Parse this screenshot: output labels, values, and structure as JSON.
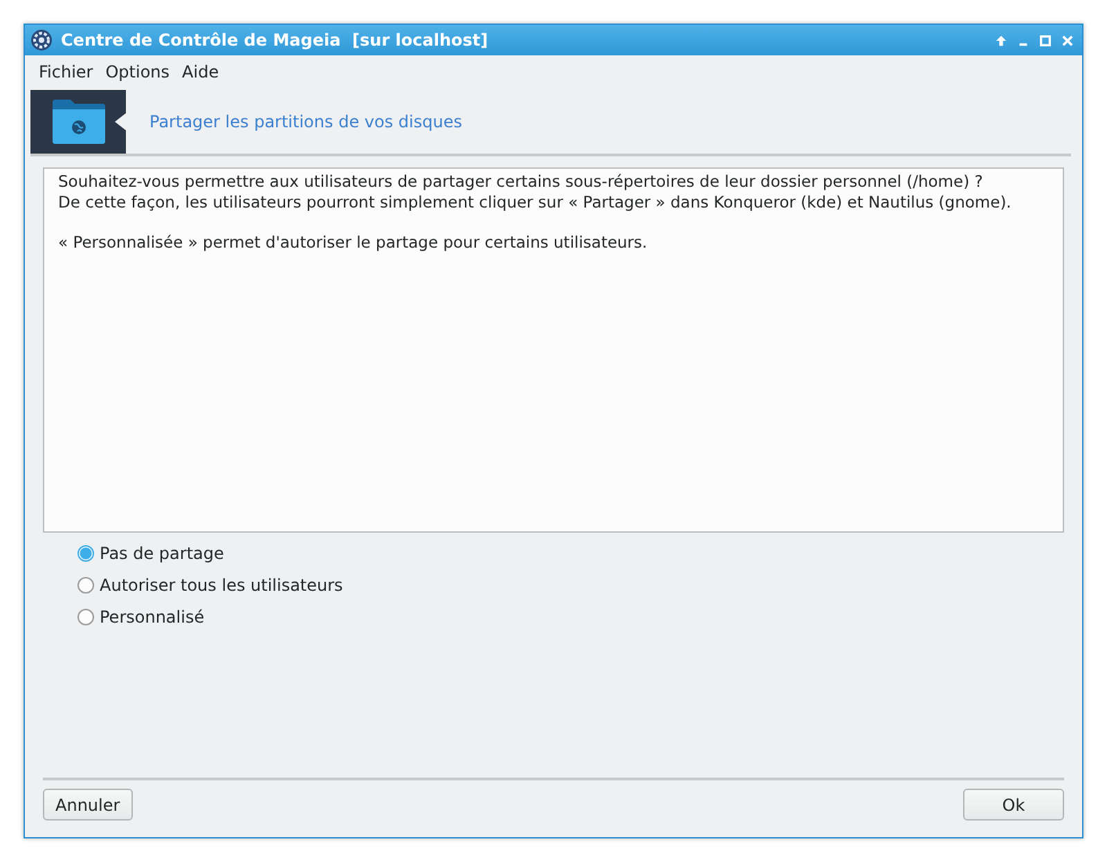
{
  "window": {
    "title": "Centre de Contrôle de Mageia  [sur localhost]"
  },
  "menu": [
    "Fichier",
    "Options",
    "Aide"
  ],
  "banner": {
    "title": "Partager les partitions de vos disques"
  },
  "message": {
    "paragraphs": [
      "Souhaitez-vous permettre aux utilisateurs de partager certains sous-répertoires de leur dossier personnel (/home) ?\nDe cette façon, les utilisateurs pourront simplement cliquer sur « Partager » dans Konqueror (kde) et Nautilus (gnome).",
      "« Personnalisée » permet d'autoriser le partage pour certains utilisateurs."
    ]
  },
  "options": [
    {
      "label": "Pas de partage",
      "selected": true
    },
    {
      "label": "Autoriser tous les utilisateurs",
      "selected": false
    },
    {
      "label": "Personnalisé",
      "selected": false
    }
  ],
  "buttons": {
    "cancel": "Annuler",
    "ok": "Ok"
  }
}
